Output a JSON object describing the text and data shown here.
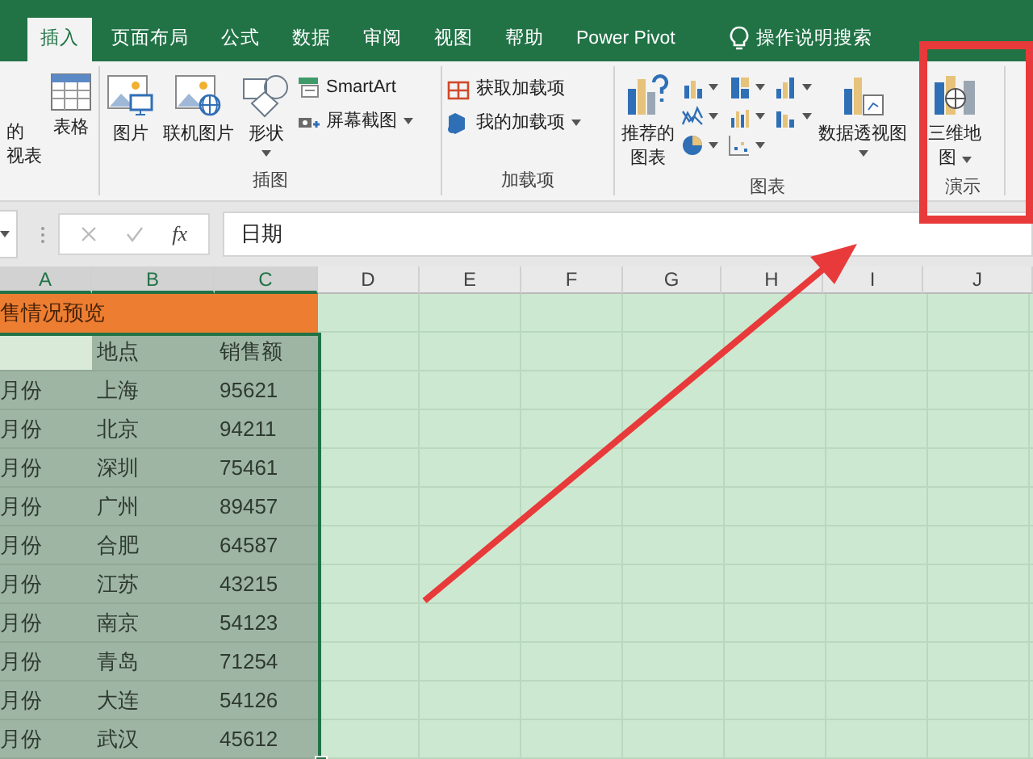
{
  "tabs": [
    {
      "label": "插入",
      "selected": true
    },
    {
      "label": "页面布局",
      "selected": false
    },
    {
      "label": "公式",
      "selected": false
    },
    {
      "label": "数据",
      "selected": false
    },
    {
      "label": "审阅",
      "selected": false
    },
    {
      "label": "视图",
      "selected": false
    },
    {
      "label": "帮助",
      "selected": false
    },
    {
      "label": "Power Pivot",
      "selected": false
    }
  ],
  "tell_me": "操作说明搜索",
  "ribbon": {
    "cut_button": [
      "的",
      "视表"
    ],
    "table": "表格",
    "illustrations": {
      "label": "插图",
      "pictures": "图片",
      "online_pictures": "联机图片",
      "shapes": "形状",
      "smartart": "SmartArt",
      "screenshot": "屏幕截图"
    },
    "addins": {
      "label": "加载项",
      "get": "获取加载项",
      "mine": "我的加载项"
    },
    "charts": {
      "label": "图表",
      "recommended": [
        "推荐的",
        "图表"
      ],
      "pivot_chart": "数据透视图"
    },
    "tours": {
      "label": "演示",
      "map": [
        "三维地",
        "图"
      ]
    }
  },
  "formula_bar": {
    "function_label": "fx",
    "value": "日期"
  },
  "sheet": {
    "columns": [
      {
        "name": "A",
        "selected": true
      },
      {
        "name": "B",
        "selected": true
      },
      {
        "name": "C",
        "selected": true
      },
      {
        "name": "D",
        "selected": false
      },
      {
        "name": "E",
        "selected": false
      },
      {
        "name": "F",
        "selected": false
      },
      {
        "name": "G",
        "selected": false
      },
      {
        "name": "H",
        "selected": false
      },
      {
        "name": "I",
        "selected": false
      },
      {
        "name": "J",
        "selected": false
      }
    ],
    "title": "售情况预览",
    "header": {
      "city": "地点",
      "amount": "销售额"
    },
    "rows": [
      {
        "month": "月份",
        "city": "上海",
        "amount": "95621"
      },
      {
        "month": "月份",
        "city": "北京",
        "amount": "94211"
      },
      {
        "month": "月份",
        "city": "深圳",
        "amount": "75461"
      },
      {
        "month": "月份",
        "city": "广州",
        "amount": "89457"
      },
      {
        "month": "月份",
        "city": "合肥",
        "amount": "64587"
      },
      {
        "month": "月份",
        "city": "江苏",
        "amount": "43215"
      },
      {
        "month": "月份",
        "city": "南京",
        "amount": "54123"
      },
      {
        "month": "月份",
        "city": "青岛",
        "amount": "71254"
      },
      {
        "month": "月份",
        "city": "大连",
        "amount": "54126"
      },
      {
        "month": "月份",
        "city": "武汉",
        "amount": "45612"
      }
    ]
  }
}
